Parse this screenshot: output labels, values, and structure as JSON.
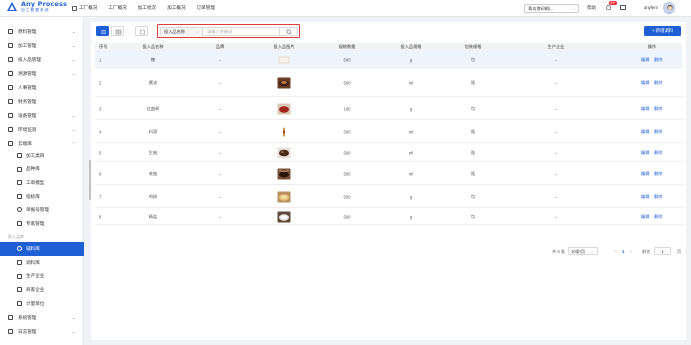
{
  "header": {
    "logo_name": "Any Process",
    "logo_sub": "加工数据系统",
    "nav": [
      {
        "label": "工厂概况",
        "icon": "home-icon"
      },
      {
        "label": "工厂概况",
        "icon": "none"
      },
      {
        "label": "加工批次",
        "icon": "none"
      },
      {
        "label": "加工概况",
        "icon": "none"
      },
      {
        "label": "订单管理",
        "icon": "none"
      }
    ],
    "tenant": "青岛港印刷(... ",
    "help": "帮助",
    "notif_count": "99+",
    "user": "anyfenl"
  },
  "sidebar": {
    "top": [
      {
        "label": "原料管理",
        "icon": "scissors-icon"
      },
      {
        "label": "加工管理",
        "icon": "hammer-icon"
      },
      {
        "label": "投入品管理",
        "icon": "box-icon"
      },
      {
        "label": "溯源管理",
        "icon": "link-icon"
      },
      {
        "label": "人事管理",
        "icon": "person-icon"
      },
      {
        "label": "财务管理",
        "icon": "finance-icon"
      },
      {
        "label": "设备管理",
        "icon": "monitor-icon"
      },
      {
        "label": "环境监测",
        "icon": "gear-icon"
      },
      {
        "label": "云端库",
        "icon": "cloud-icon"
      }
    ],
    "sub": [
      {
        "label": "加工类目",
        "icon": "tag-icon"
      },
      {
        "label": "品种库",
        "icon": "grid-icon"
      },
      {
        "label": "工单模型",
        "icon": "model-icon"
      },
      {
        "label": "指标库",
        "icon": "doc-icon"
      },
      {
        "label": "单据号管理",
        "icon": "clock-icon"
      },
      {
        "label": "专家管理",
        "icon": "people-icon"
      }
    ],
    "group_label": "投入品库",
    "sub2": [
      {
        "label": "辅料库",
        "icon": "circle-icon",
        "active": true
      },
      {
        "label": "调料库",
        "icon": "square-icon"
      },
      {
        "label": "生产企业",
        "icon": "building-icon"
      },
      {
        "label": "商家企业",
        "icon": "cart-icon"
      },
      {
        "label": "计量单位",
        "icon": "pin-icon"
      }
    ],
    "bottom": [
      {
        "label": "系统管理",
        "icon": "system-icon"
      },
      {
        "label": "日志管理",
        "icon": "log-icon"
      }
    ]
  },
  "toolbar": {
    "search_select": "投入品名称",
    "search_placeholder": "请输入关键词",
    "add_label": "+ 新增调料"
  },
  "table": {
    "headers": [
      "序号",
      "投入品名称",
      "品牌",
      "投入品图片",
      "规格数量",
      "投入品规格",
      "包装规格",
      "生产企业",
      "操作"
    ],
    "rows": [
      {
        "no": "1",
        "name": "糖",
        "brand": "--",
        "img": "sugar",
        "qty": "500",
        "spec": "g",
        "pack": "包",
        "maker": "--"
      },
      {
        "no": "2",
        "name": "酱油",
        "brand": "--",
        "img": "soy",
        "qty": "500",
        "spec": "ml",
        "pack": "瓶",
        "maker": "--"
      },
      {
        "no": "3",
        "name": "红曲粉",
        "brand": "--",
        "img": "redpowder",
        "qty": "100",
        "spec": "g",
        "pack": "包",
        "maker": "--"
      },
      {
        "no": "4",
        "name": "料酒",
        "brand": "--",
        "img": "wine",
        "qty": "500",
        "spec": "ml",
        "pack": "瓶",
        "maker": "--"
      },
      {
        "no": "5",
        "name": "生抽",
        "brand": "--",
        "img": "lightsoy",
        "qty": "500",
        "spec": "ml",
        "pack": "瓶",
        "maker": "--"
      },
      {
        "no": "6",
        "name": "老抽",
        "brand": "--",
        "img": "darksoy",
        "qty": "500",
        "spec": "ml",
        "pack": "瓶",
        "maker": "--"
      },
      {
        "no": "7",
        "name": "鸡粉",
        "brand": "--",
        "img": "chicken",
        "qty": "500",
        "spec": "g",
        "pack": "包",
        "maker": "--"
      },
      {
        "no": "8",
        "name": "精盐",
        "brand": "--",
        "img": "salt",
        "qty": "500",
        "spec": "g",
        "pack": "包",
        "maker": "--"
      }
    ],
    "op_edit": "编辑",
    "op_delete": "删除"
  },
  "pager": {
    "total": "共 8 条",
    "size": "10条/页",
    "prev": "<",
    "current": "1",
    "next": ">",
    "goto": "前往",
    "page_input": "1",
    "page_unit": "页"
  },
  "colors": {
    "primary": "#1f5fd6",
    "highlight": "#e03a3a"
  }
}
